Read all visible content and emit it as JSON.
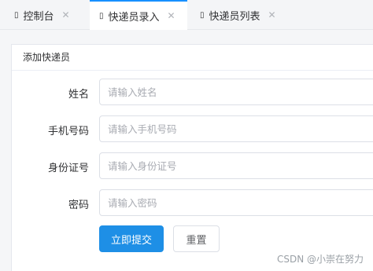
{
  "tabs": [
    {
      "label": "控制台",
      "icon": "page-icon",
      "active": false
    },
    {
      "label": "快递员录入",
      "icon": "page-icon",
      "active": true
    },
    {
      "label": "快递员列表",
      "icon": "page-icon",
      "active": false
    }
  ],
  "tab_close_glyph": "✕",
  "tab_icon_glyph": "▯",
  "card": {
    "title": "添加快递员"
  },
  "form": {
    "fields": [
      {
        "label": "姓名",
        "placeholder": "请输入姓名"
      },
      {
        "label": "手机号码",
        "placeholder": "请输入手机号码"
      },
      {
        "label": "身份证号",
        "placeholder": "请输入身份证号"
      },
      {
        "label": "密码",
        "placeholder": "请输入密码"
      }
    ],
    "submit_label": "立即提交",
    "reset_label": "重置"
  },
  "watermark": "CSDN @小崇在努力",
  "colors": {
    "primary": "#1e8fe6",
    "tab_active_border": "#1890ff"
  }
}
